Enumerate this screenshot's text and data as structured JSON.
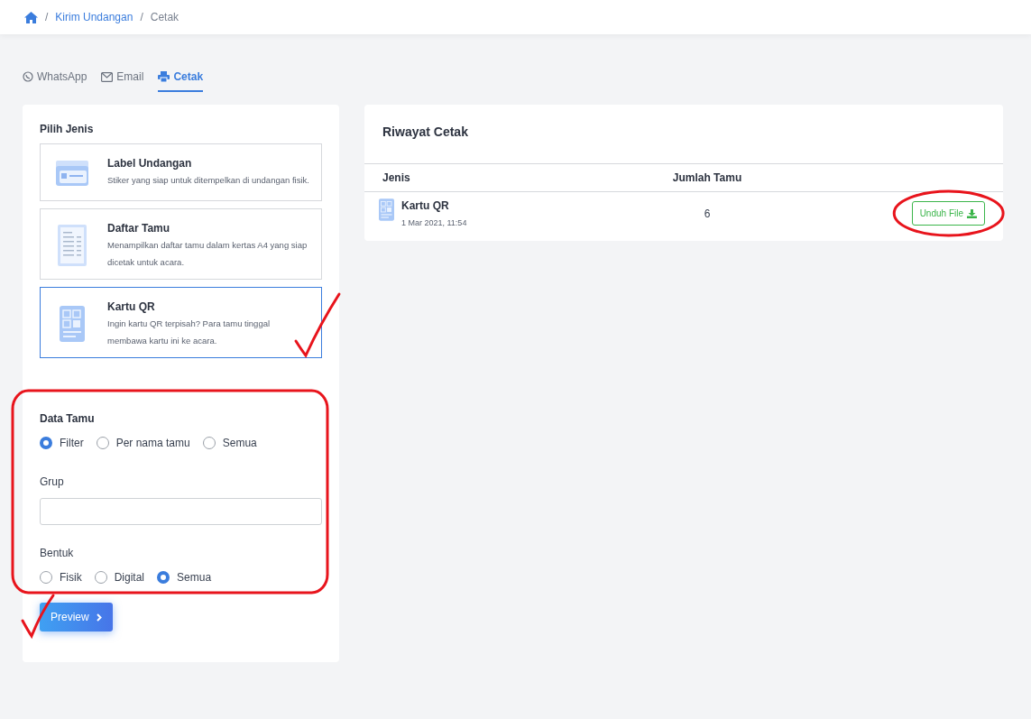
{
  "breadcrumb": [
    {
      "label": "/",
      "kind": "separator"
    },
    {
      "label": "Kirim Undangan",
      "kind": "link"
    },
    {
      "label": "/",
      "kind": "separator"
    },
    {
      "label": "Cetak",
      "kind": "current"
    }
  ],
  "tabs": [
    {
      "label": "WhatsApp",
      "kind": "whatsapp",
      "selected": false
    },
    {
      "label": "Email",
      "kind": "email",
      "selected": false
    },
    {
      "label": "Cetak",
      "kind": "print",
      "selected": true
    }
  ],
  "pilih_jenis": {
    "title": "Pilih Jenis",
    "options": [
      {
        "title": "Label Undangan",
        "description": "Stiker yang siap untuk ditempelkan di undangan fisik.",
        "kind": "label",
        "selected": false
      },
      {
        "title": "Daftar Tamu",
        "description": "Menampilkan daftar tamu dalam kertas A4 yang siap dicetak untuk acara.",
        "kind": "list",
        "selected": false
      },
      {
        "title": "Kartu QR",
        "description": "Ingin kartu QR terpisah? Para tamu tinggal membawa kartu ini ke acara.",
        "kind": "qr",
        "selected": true
      }
    ]
  },
  "data_tamu": {
    "title": "Data Tamu",
    "options": [
      {
        "label": "Filter",
        "selected": true
      },
      {
        "label": "Per nama tamu",
        "selected": false
      },
      {
        "label": "Semua",
        "selected": false
      }
    ]
  },
  "grup": {
    "label": "Grup"
  },
  "bentuk": {
    "label": "Bentuk",
    "options": [
      {
        "label": "Fisik",
        "selected": false
      },
      {
        "label": "Digital",
        "selected": false
      },
      {
        "label": "Semua",
        "selected": true
      }
    ]
  },
  "preview_button": "Preview",
  "riwayat": {
    "title": "Riwayat Cetak",
    "columns": [
      "Jenis",
      "Jumlah Tamu"
    ],
    "rows": [
      {
        "jenis": "Kartu QR",
        "date": "1 Mar 2021, 11:54",
        "jumlah": "6",
        "action": "Unduh File"
      }
    ]
  }
}
